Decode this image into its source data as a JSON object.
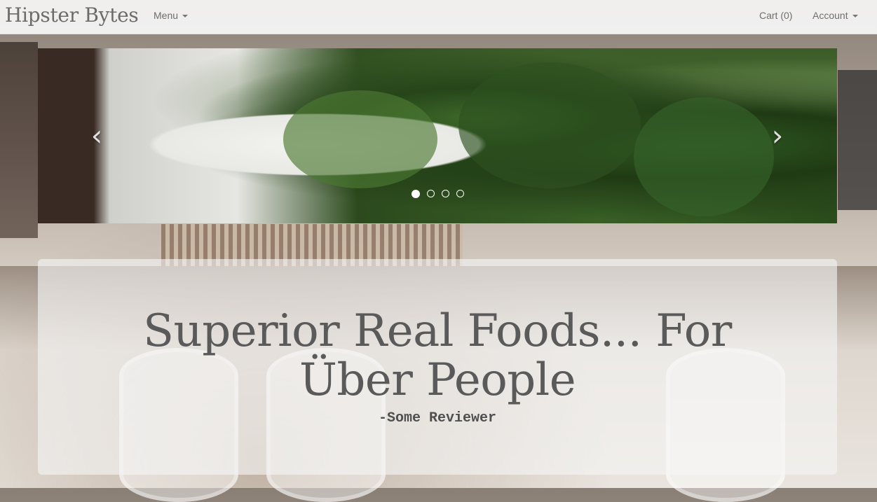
{
  "navbar": {
    "brand": "Hipster Bytes",
    "menu_label": "Menu",
    "cart_label": "Cart (0)",
    "account_label": "Account"
  },
  "carousel": {
    "prev_icon": "chevron-left-icon",
    "next_icon": "chevron-right-icon",
    "indicator_count": 4,
    "active_index": 0
  },
  "hero": {
    "quote": "Superior Real Foods... For Über People",
    "attribution": "-Some Reviewer"
  }
}
